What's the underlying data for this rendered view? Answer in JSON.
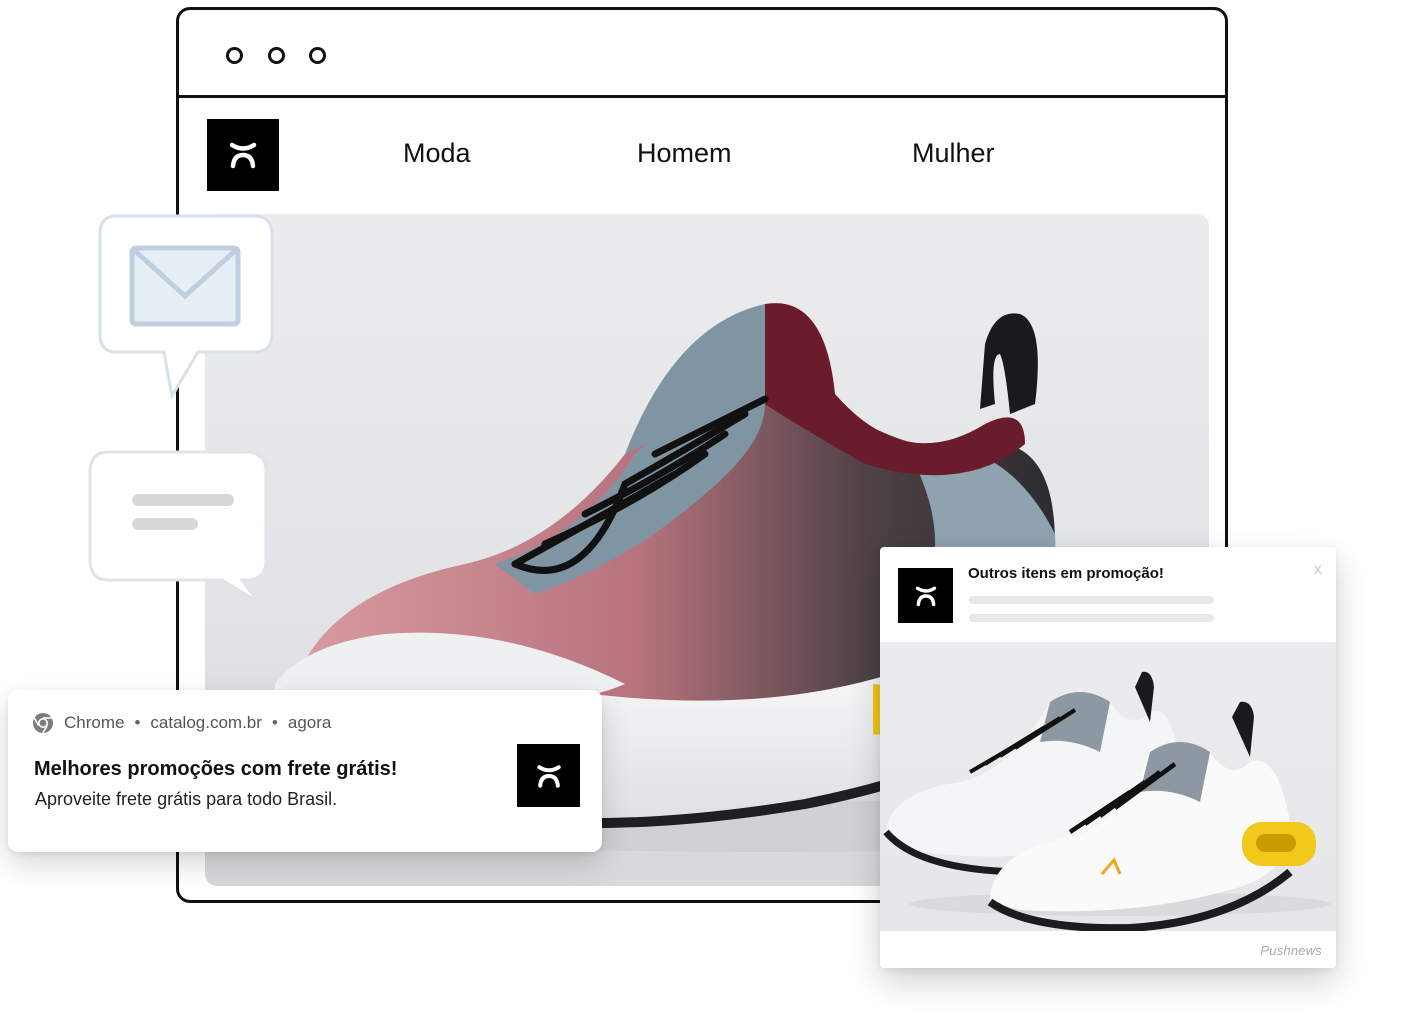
{
  "browser": {
    "nav": [
      {
        "label": "Moda"
      },
      {
        "label": "Homem"
      },
      {
        "label": "Mulher"
      }
    ]
  },
  "notification": {
    "app": "Chrome",
    "domain": "catalog.com.br",
    "time": "agora",
    "separator": "•",
    "title": "Melhores promoções com frete grátis!",
    "body": "Aproveite frete grátis para todo Brasil."
  },
  "popup": {
    "title": "Outros itens em promoção!",
    "close_label": "x",
    "brand": "Pushnews"
  },
  "colors": {
    "brand_black": "#000000",
    "shoe_accent_yellow": "#f2c81a",
    "shoe_burgundy": "#6a1c2c",
    "shoe_slate": "#7f95a4"
  },
  "icons": [
    "mail-icon",
    "chat-icon",
    "chrome-icon",
    "brand-logo-icon"
  ]
}
